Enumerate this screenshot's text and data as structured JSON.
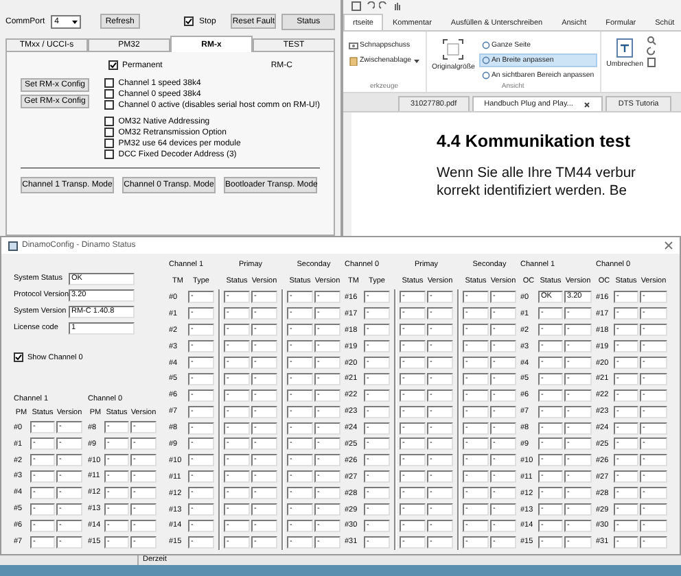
{
  "config_window": {
    "port_label": "CommPort",
    "port_value": "4",
    "refresh": "Refresh",
    "stop": {
      "label": "Stop",
      "checked": true
    },
    "reset": "Reset Fault",
    "status": "Status",
    "tabs": [
      {
        "label": "TMxx / UCCI-s",
        "selected": false
      },
      {
        "label": "PM32",
        "selected": false
      },
      {
        "label": "RM-x",
        "selected": true
      },
      {
        "label": "TEST",
        "selected": false
      }
    ],
    "permanent": {
      "label": "Permanent",
      "checked": true
    },
    "model": "RM-C",
    "config_buttons": [
      "Set RM-x Config",
      "Get RM-x Config"
    ],
    "option_groups": [
      [
        {
          "label": "Channel 1 speed 38k4",
          "checked": false
        },
        {
          "label": "Channel 0 speed 38k4",
          "checked": false
        },
        {
          "label": "Channel 0 active (disables serial host comm on RM-U!)",
          "checked": false
        }
      ],
      [
        {
          "label": "OM32 Native Addressing",
          "checked": false
        },
        {
          "label": "OM32 Retransmission Option",
          "checked": false
        },
        {
          "label": "PM32 use 64 devices per module",
          "checked": false
        },
        {
          "label": "DCC Fixed Decoder Address (3)",
          "checked": false
        }
      ]
    ],
    "mode_buttons": [
      "Channel 1 Transp. Mode",
      "Channel 0 Transp. Mode",
      "Bootloader Transp. Mode"
    ]
  },
  "pdf_reader": {
    "ribbon_tabs": [
      {
        "label": "rtseite",
        "selected": true
      },
      {
        "label": "Kommentar",
        "selected": false
      },
      {
        "label": "Ausfüllen & Unterschreiben",
        "selected": false
      },
      {
        "label": "Ansicht",
        "selected": false
      },
      {
        "label": "Formular",
        "selected": false
      },
      {
        "label": "Schüt",
        "selected": false
      }
    ],
    "tools": [
      "Schnappschuss",
      "Zwischenablage"
    ],
    "tools_group": "erkzeuge",
    "original_size": "Originalgröße",
    "view_options": [
      {
        "label": "Ganze Seite",
        "selected": false
      },
      {
        "label": "An Breite anpassen",
        "selected": true
      },
      {
        "label": "An sichtbaren Bereich anpassen",
        "selected": false
      }
    ],
    "view_group": "Ansicht",
    "reflow": "Umbrechen",
    "doc_tabs": [
      {
        "label": "31027780.pdf",
        "selected": false
      },
      {
        "label": "Handbuch Plug and Play...",
        "selected": true
      },
      {
        "label": "DTS Tutoria",
        "selected": false
      }
    ],
    "heading": "4.4  Kommunikation test",
    "body_lines": [
      "Wenn Sie alle Ihre TM44 verbur",
      "korrekt identifiziert werden. Be"
    ]
  },
  "status_window": {
    "title": "DinamoConfig - Dinamo Status",
    "fields": [
      {
        "label": "System Status",
        "value": "OK"
      },
      {
        "label": "Protocol Version",
        "value": "3.20"
      },
      {
        "label": "System Version",
        "value": "RM-C 1.40.8"
      },
      {
        "label": "License code",
        "value": "1"
      }
    ],
    "show_channel": {
      "label": "Show Channel 0",
      "checked": true
    },
    "pm_tables": [
      {
        "title": "Channel 1",
        "columns": [
          "PM",
          "Status",
          "Version"
        ],
        "rows": [
          [
            "#0",
            "-",
            "-"
          ],
          [
            "#1",
            "-",
            "-"
          ],
          [
            "#2",
            "-",
            "-"
          ],
          [
            "#3",
            "-",
            "-"
          ],
          [
            "#4",
            "-",
            "-"
          ],
          [
            "#5",
            "-",
            "-"
          ],
          [
            "#6",
            "-",
            "-"
          ],
          [
            "#7",
            "-",
            "-"
          ]
        ]
      },
      {
        "title": "Channel 0",
        "columns": [
          "PM",
          "Status",
          "Version"
        ],
        "rows": [
          [
            "#8",
            "-",
            "-"
          ],
          [
            "#9",
            "-",
            "-"
          ],
          [
            "#10",
            "-",
            "-"
          ],
          [
            "#11",
            "-",
            "-"
          ],
          [
            "#12",
            "-",
            "-"
          ],
          [
            "#13",
            "-",
            "-"
          ],
          [
            "#14",
            "-",
            "-"
          ],
          [
            "#15",
            "-",
            "-"
          ]
        ]
      }
    ],
    "tm_tables": [
      {
        "title": "Channel 1",
        "groups": [
          "Primay",
          "Seconday"
        ],
        "columns": [
          "TM",
          "Type",
          "Status",
          "Version",
          "Status",
          "Version"
        ],
        "rows": [
          [
            "#0",
            "-",
            "-",
            "-",
            "-",
            "-"
          ],
          [
            "#1",
            "-",
            "-",
            "-",
            "-",
            "-"
          ],
          [
            "#2",
            "-",
            "-",
            "-",
            "-",
            "-"
          ],
          [
            "#3",
            "-",
            "-",
            "-",
            "-",
            "-"
          ],
          [
            "#4",
            "-",
            "-",
            "-",
            "-",
            "-"
          ],
          [
            "#5",
            "-",
            "-",
            "-",
            "-",
            "-"
          ],
          [
            "#6",
            "-",
            "-",
            "-",
            "-",
            "-"
          ],
          [
            "#7",
            "-",
            "-",
            "-",
            "-",
            "-"
          ],
          [
            "#8",
            "-",
            "-",
            "-",
            "-",
            "-"
          ],
          [
            "#9",
            "-",
            "-",
            "-",
            "-",
            "-"
          ],
          [
            "#10",
            "-",
            "-",
            "-",
            "-",
            "-"
          ],
          [
            "#11",
            "-",
            "-",
            "-",
            "-",
            "-"
          ],
          [
            "#12",
            "-",
            "-",
            "-",
            "-",
            "-"
          ],
          [
            "#13",
            "-",
            "-",
            "-",
            "-",
            "-"
          ],
          [
            "#14",
            "-",
            "-",
            "-",
            "-",
            "-"
          ],
          [
            "#15",
            "-",
            "-",
            "-",
            "-",
            "-"
          ]
        ]
      },
      {
        "title": "Channel 0",
        "groups": [
          "Primay",
          "Seconday"
        ],
        "columns": [
          "TM",
          "Type",
          "Status",
          "Version",
          "Status",
          "Version"
        ],
        "rows": [
          [
            "#16",
            "-",
            "-",
            "-",
            "-",
            "-"
          ],
          [
            "#17",
            "-",
            "-",
            "-",
            "-",
            "-"
          ],
          [
            "#18",
            "-",
            "-",
            "-",
            "-",
            "-"
          ],
          [
            "#19",
            "-",
            "-",
            "-",
            "-",
            "-"
          ],
          [
            "#20",
            "-",
            "-",
            "-",
            "-",
            "-"
          ],
          [
            "#21",
            "-",
            "-",
            "-",
            "-",
            "-"
          ],
          [
            "#22",
            "-",
            "-",
            "-",
            "-",
            "-"
          ],
          [
            "#23",
            "-",
            "-",
            "-",
            "-",
            "-"
          ],
          [
            "#24",
            "-",
            "-",
            "-",
            "-",
            "-"
          ],
          [
            "#25",
            "-",
            "-",
            "-",
            "-",
            "-"
          ],
          [
            "#26",
            "-",
            "-",
            "-",
            "-",
            "-"
          ],
          [
            "#27",
            "-",
            "-",
            "-",
            "-",
            "-"
          ],
          [
            "#28",
            "-",
            "-",
            "-",
            "-",
            "-"
          ],
          [
            "#29",
            "-",
            "-",
            "-",
            "-",
            "-"
          ],
          [
            "#30",
            "-",
            "-",
            "-",
            "-",
            "-"
          ],
          [
            "#31",
            "-",
            "-",
            "-",
            "-",
            "-"
          ]
        ]
      }
    ],
    "oc_tables": [
      {
        "title": "Channel 1",
        "columns": [
          "OC",
          "Status",
          "Version"
        ],
        "rows": [
          [
            "#0",
            "OK",
            "3.20"
          ],
          [
            "#1",
            "-",
            "-"
          ],
          [
            "#2",
            "-",
            "-"
          ],
          [
            "#3",
            "-",
            "-"
          ],
          [
            "#4",
            "-",
            "-"
          ],
          [
            "#5",
            "-",
            "-"
          ],
          [
            "#6",
            "-",
            "-"
          ],
          [
            "#7",
            "-",
            "-"
          ],
          [
            "#8",
            "-",
            "-"
          ],
          [
            "#9",
            "-",
            "-"
          ],
          [
            "#10",
            "-",
            "-"
          ],
          [
            "#11",
            "-",
            "-"
          ],
          [
            "#12",
            "-",
            "-"
          ],
          [
            "#13",
            "-",
            "-"
          ],
          [
            "#14",
            "-",
            "-"
          ],
          [
            "#15",
            "-",
            "-"
          ]
        ]
      },
      {
        "title": "Channel 0",
        "columns": [
          "OC",
          "Status",
          "Version"
        ],
        "rows": [
          [
            "#16",
            "-",
            "-"
          ],
          [
            "#17",
            "-",
            "-"
          ],
          [
            "#18",
            "-",
            "-"
          ],
          [
            "#19",
            "-",
            "-"
          ],
          [
            "#20",
            "-",
            "-"
          ],
          [
            "#21",
            "-",
            "-"
          ],
          [
            "#22",
            "-",
            "-"
          ],
          [
            "#23",
            "-",
            "-"
          ],
          [
            "#24",
            "-",
            "-"
          ],
          [
            "#25",
            "-",
            "-"
          ],
          [
            "#26",
            "-",
            "-"
          ],
          [
            "#27",
            "-",
            "-"
          ],
          [
            "#28",
            "-",
            "-"
          ],
          [
            "#29",
            "-",
            "-"
          ],
          [
            "#30",
            "-",
            "-"
          ],
          [
            "#31",
            "-",
            "-"
          ]
        ]
      }
    ]
  },
  "status_strip": {
    "text": "Derzeit"
  }
}
